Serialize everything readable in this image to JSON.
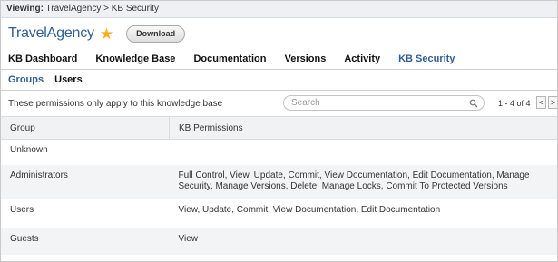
{
  "viewing": {
    "label": "Viewing:",
    "path": "TravelAgency > KB Security"
  },
  "header": {
    "title": "TravelAgency",
    "star_icon": "star-icon",
    "download_label": "Download"
  },
  "main_nav": {
    "items": [
      {
        "label": "KB Dashboard",
        "active": false
      },
      {
        "label": "Knowledge Base",
        "active": false
      },
      {
        "label": "Documentation",
        "active": false
      },
      {
        "label": "Versions",
        "active": false
      },
      {
        "label": "Activity",
        "active": false
      },
      {
        "label": "KB Security",
        "active": true
      }
    ]
  },
  "sub_nav": {
    "items": [
      {
        "label": "Groups",
        "active": true
      },
      {
        "label": "Users",
        "active": false
      }
    ]
  },
  "toolbar": {
    "note": "These permissions only apply to this knowledge base",
    "search_placeholder": "Search",
    "pager_text": "1 - 4 of 4",
    "prev_label": "<",
    "next_label": ">"
  },
  "table": {
    "columns": [
      "Group",
      "KB Permissions"
    ],
    "rows": [
      {
        "group": "Unknown",
        "permissions": ""
      },
      {
        "group": "Administrators",
        "permissions": "Full Control, View, Update, Commit, View Documentation, Edit Documentation, Manage Security, Manage Versions, Delete, Manage Locks, Commit To Protected Versions"
      },
      {
        "group": "Users",
        "permissions": "View, Update, Commit, View Documentation, Edit Documentation"
      },
      {
        "group": "Guests",
        "permissions": "View"
      }
    ]
  },
  "colors": {
    "accent": "#2e5f94",
    "star": "#f5b120",
    "header_bg": "#eef0f3"
  }
}
